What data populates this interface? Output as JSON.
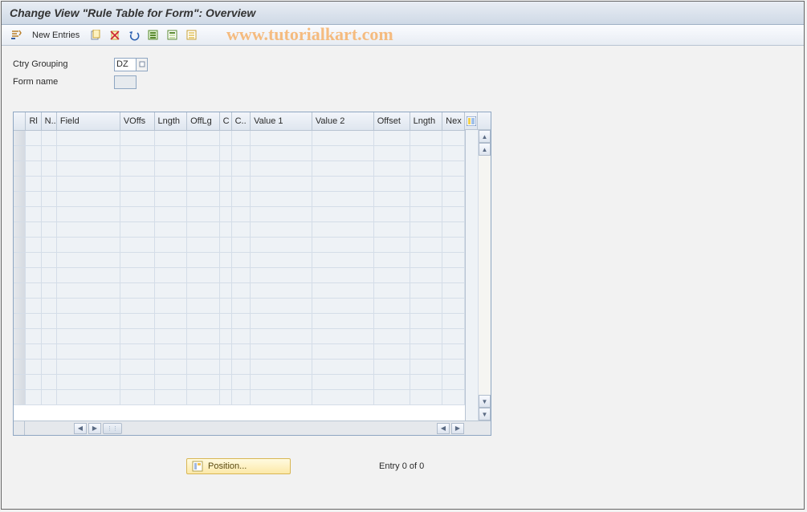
{
  "title": "Change View \"Rule Table for Form\": Overview",
  "watermark": "www.tutorialkart.com",
  "toolbar": {
    "new_entries": "New Entries"
  },
  "form": {
    "ctry_grouping_label": "Ctry Grouping",
    "ctry_grouping_value": "DZ",
    "form_name_label": "Form name",
    "form_name_value": ""
  },
  "grid": {
    "columns": [
      "Rl",
      "N..",
      "Field",
      "VOffs",
      "Lngth",
      "OffLg",
      "C",
      "C..",
      "Value 1",
      "Value 2",
      "Offset",
      "Lngth",
      "Nex"
    ],
    "row_count": 18
  },
  "footer": {
    "position_label": "Position...",
    "entry_text": "Entry 0 of 0"
  }
}
